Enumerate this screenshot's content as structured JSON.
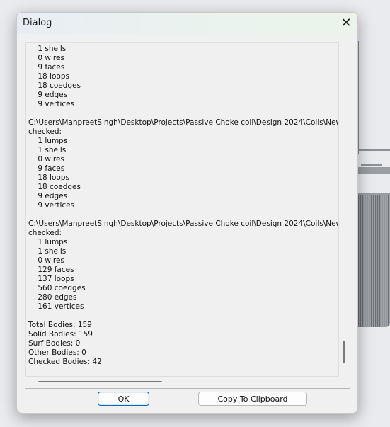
{
  "dialog": {
    "title": "Dialog",
    "close_icon": "close-icon",
    "log_lines": [
      "    1 shells",
      "    0 wires",
      "    9 faces",
      "    18 loops",
      "    18 coedges",
      "    9 edges",
      "    9 vertices",
      "",
      "C:\\Users\\ManpreetSingh\\Desktop\\Projects\\Passive Choke coil\\Design 2024\\Coils\\New Coil",
      "checked:",
      "    1 lumps",
      "    1 shells",
      "    0 wires",
      "    9 faces",
      "    18 loops",
      "    18 coedges",
      "    9 edges",
      "    9 vertices",
      "",
      "C:\\Users\\ManpreetSingh\\Desktop\\Projects\\Passive Choke coil\\Design 2024\\Coils\\New Coil",
      "checked:",
      "    1 lumps",
      "    1 shells",
      "    0 wires",
      "    129 faces",
      "    137 loops",
      "    560 coedges",
      "    280 edges",
      "    161 vertices",
      "",
      "Total Bodies: 159",
      "Solid Bodies: 159",
      "Surf Bodies: 0",
      "Other Bodies: 0",
      "Checked Bodies: 42"
    ],
    "buttons": {
      "ok_label": "OK",
      "copy_label": "Copy To Clipboard"
    }
  }
}
